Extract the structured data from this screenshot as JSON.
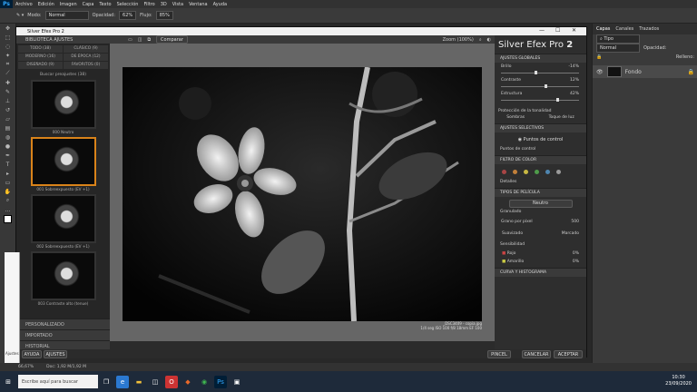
{
  "ps": {
    "logo": "Ps",
    "menu": [
      "Archivo",
      "Edición",
      "Imagen",
      "Capa",
      "Texto",
      "Selección",
      "Filtro",
      "3D",
      "Vista",
      "Ventana",
      "Ayuda"
    ],
    "options": {
      "mode_label": "Modo:",
      "mode_value": "Normal",
      "opacity_label": "Opacidad:",
      "opacity_value": "62%",
      "flow_label": "Flujo:",
      "flow_value": "85%"
    },
    "panel_tabs": [
      "Capas",
      "Canales",
      "Trazados"
    ],
    "layer_name": "Fondo",
    "fill_label": "Relleno:",
    "opacity_label": "Opacidad:",
    "status_zoom": "66,67%",
    "status_doc": "Doc: 1,92 M/1,92 M",
    "search_label": "Ajustes"
  },
  "plugin": {
    "title": "Silver Efex Pro 2",
    "left_header": "BIBLIOTECA AJUSTES",
    "filters": [
      "TODO (38)",
      "CLÁSICO (9)",
      "MODERNO (16)",
      "DE ÉPOCA (12)",
      "DISEÑADO (9)",
      "FAVORITOS (0)"
    ],
    "import_label": "Buscar preajustes (38)",
    "presets": [
      "000 Neutro",
      "001 Sobreexpuesto (EV +1)",
      "002 Sobreexpuesto (EV +1)",
      "003 Contraste alto (tenue)"
    ],
    "bottom_sections": [
      "PERSONALIZADO",
      "IMPORTADO",
      "HISTORIAL"
    ],
    "toolbar_compare": "Comparar",
    "zoom_label": "Zoom (100%)",
    "photo_info": [
      "_DSC3409 - copia.jpg",
      "1/4 seg  ISO 100  f/8  18mm  EF 100"
    ],
    "brand_title": "Silver Efex Pro",
    "brand_version": "2",
    "sections": {
      "global": "AJUSTES GLOBALES",
      "selective": "AJUSTES SELECTIVOS",
      "filter": "FILTRO DE COLOR",
      "film": "TIPOS DE PELÍCULA",
      "curve": "CURVA Y HISTOGRAMA"
    },
    "sliders": [
      {
        "label": "Brillo",
        "value": "-14%",
        "pos": 0.43
      },
      {
        "label": "Contraste",
        "value": "12%",
        "pos": 0.56
      },
      {
        "label": "Estructura",
        "value": "42%",
        "pos": 0.71
      }
    ],
    "tonal_label": "Protección de la tonalidad",
    "shadows_label": "Sombras",
    "highlights_label": "Toque de luz",
    "control_points": "Puntos de control",
    "control_points_small": "Puntos de control",
    "details_label": "Detalles",
    "film_value": "Neutro",
    "grain_label": "Granulado",
    "grain_per_pixel": "Grano por píxel",
    "grain_value": "500",
    "soft_label": "Suavizado",
    "hard_label": "Marcado",
    "sensitivity_label": "Sensibilidad",
    "sens_red": "Rojo",
    "sens_yellow": "Amarillo",
    "sens_red_val": "0%",
    "sens_yellow_val": "0%",
    "swatch_colors": [
      "#a84545",
      "#c2803a",
      "#c8b843",
      "#4e9c4a",
      "#4f86b0",
      "#9a9a9a"
    ],
    "footer": {
      "help": "AYUDA",
      "settings": "AJUSTES",
      "brush": "PINCEL",
      "cancel": "CANCELAR",
      "accept": "ACEPTAR"
    }
  },
  "taskbar": {
    "search_placeholder": "Escribe aquí para buscar",
    "time": "10:30",
    "date": "23/09/2020"
  }
}
